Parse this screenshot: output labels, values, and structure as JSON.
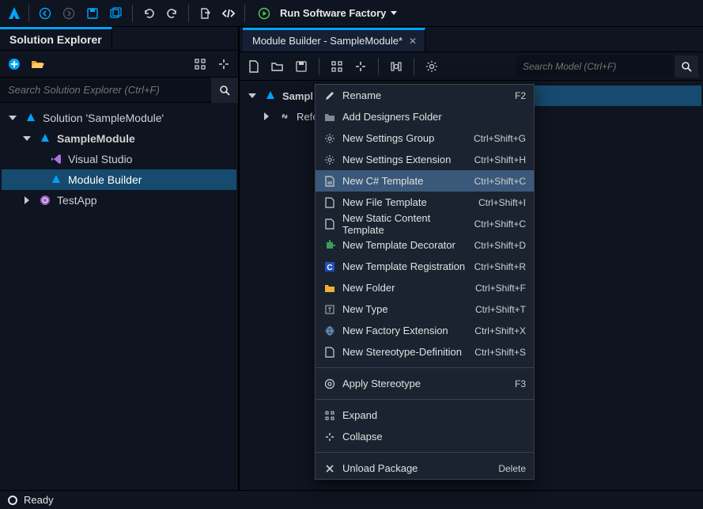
{
  "topbar": {
    "run_label": "Run Software Factory"
  },
  "solution_explorer": {
    "title": "Solution Explorer",
    "search_placeholder": "Search Solution Explorer (Ctrl+F)",
    "tree": {
      "solution_label": "Solution 'SampleModule'",
      "project_label": "SampleModule",
      "vs_label": "Visual Studio",
      "mb_label": "Module Builder",
      "testapp_label": "TestApp"
    }
  },
  "editor": {
    "tab_title": "Module Builder - SampleModule*",
    "search_placeholder": "Search Model (Ctrl+F)",
    "tree": {
      "root": "SampleModule",
      "references": "References"
    }
  },
  "context_menu": {
    "items": [
      {
        "label": "Rename",
        "shortcut": "F2",
        "icon": "pencil"
      },
      {
        "label": "Add Designers Folder",
        "shortcut": "",
        "icon": "folder-grey"
      },
      {
        "label": "New Settings Group",
        "shortcut": "Ctrl+Shift+G",
        "icon": "gear"
      },
      {
        "label": "New Settings Extension",
        "shortcut": "Ctrl+Shift+H",
        "icon": "gear"
      },
      {
        "label": "New C# Template",
        "shortcut": "Ctrl+Shift+C",
        "icon": "file-cs",
        "highlight": true
      },
      {
        "label": "New File Template",
        "shortcut": "Ctrl+Shift+I",
        "icon": "file"
      },
      {
        "label": "New Static Content Template",
        "shortcut": "Ctrl+Shift+C",
        "icon": "file"
      },
      {
        "label": "New Template Decorator",
        "shortcut": "Ctrl+Shift+D",
        "icon": "puzzle"
      },
      {
        "label": "New Template Registration",
        "shortcut": "Ctrl+Shift+R",
        "icon": "c-box"
      },
      {
        "label": "New Folder",
        "shortcut": "Ctrl+Shift+F",
        "icon": "folder-yellow"
      },
      {
        "label": "New Type",
        "shortcut": "Ctrl+Shift+T",
        "icon": "type"
      },
      {
        "label": "New Factory Extension",
        "shortcut": "Ctrl+Shift+X",
        "icon": "globe"
      },
      {
        "label": "New Stereotype-Definition",
        "shortcut": "Ctrl+Shift+S",
        "icon": "file"
      }
    ],
    "apply_label": "Apply Stereotype",
    "apply_shortcut": "F3",
    "expand_label": "Expand",
    "collapse_label": "Collapse",
    "unload_label": "Unload Package",
    "unload_shortcut": "Delete"
  },
  "status": {
    "text": "Ready"
  }
}
